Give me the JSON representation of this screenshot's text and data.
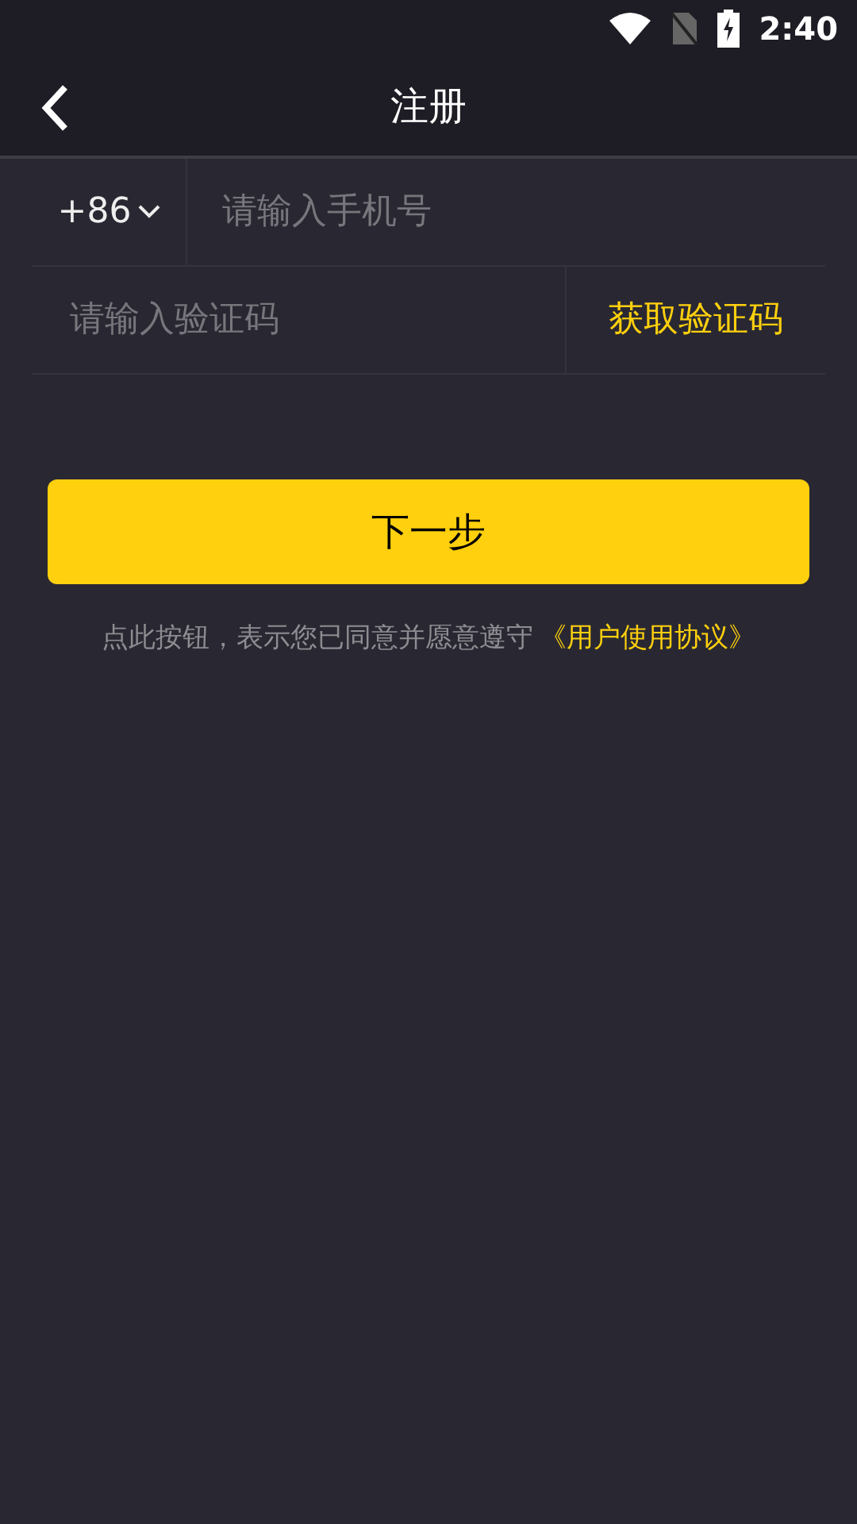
{
  "status_bar": {
    "time": "2:40"
  },
  "header": {
    "title": "注册"
  },
  "phone": {
    "country_code": "+86",
    "placeholder": "请输入手机号"
  },
  "code": {
    "placeholder": "请输入验证码",
    "send_button": "获取验证码"
  },
  "next_button": "下一步",
  "agreement": {
    "text": "点此按钮，表示您已同意并愿意遵守",
    "link": "《用户使用协议》"
  }
}
